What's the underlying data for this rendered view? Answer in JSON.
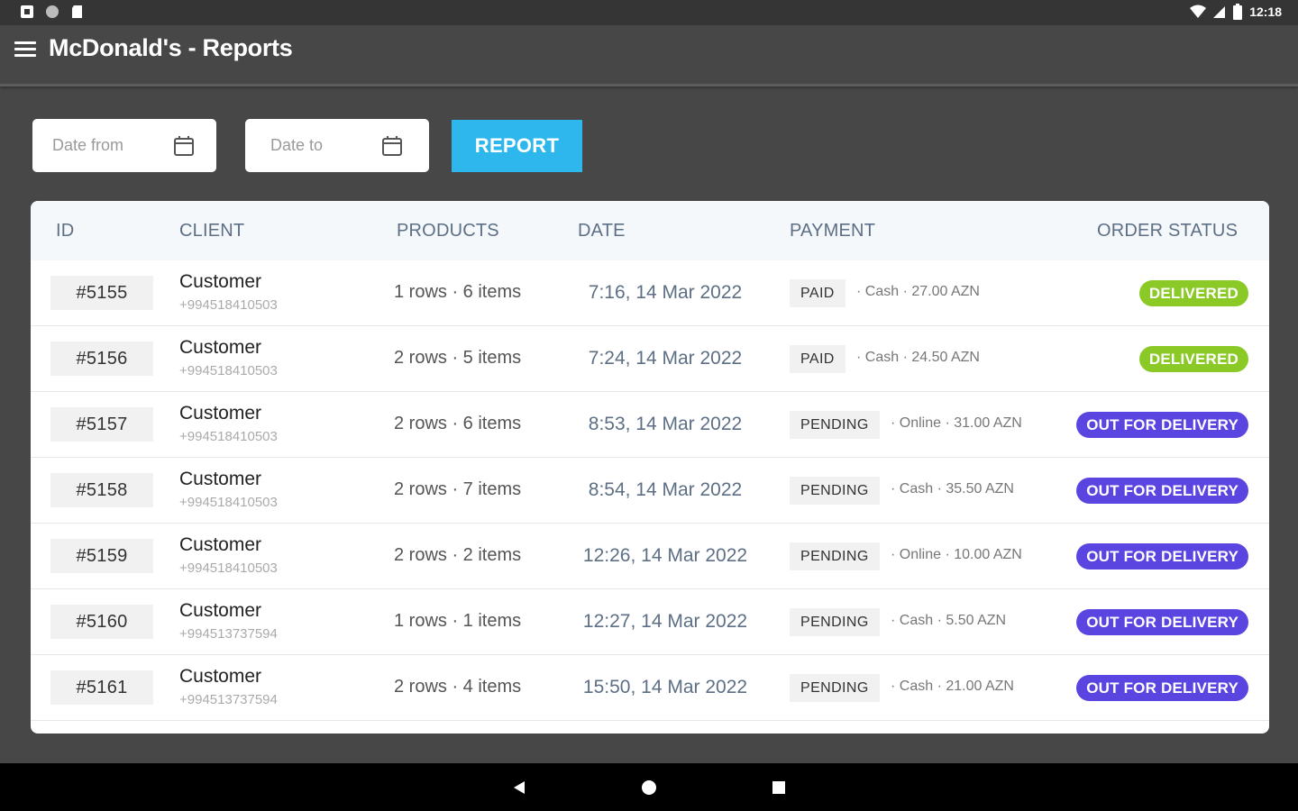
{
  "status_bar": {
    "time": "12:18"
  },
  "app": {
    "title": "McDonald's - Reports"
  },
  "filters": {
    "date_from_placeholder": "Date from",
    "date_to_placeholder": "Date to",
    "report_label": "REPORT"
  },
  "table": {
    "headers": [
      "ID",
      "CLIENT",
      "PRODUCTS",
      "DATE",
      "PAYMENT",
      "ORDER STATUS"
    ],
    "rows": [
      {
        "id": "#5155",
        "client": "Customer",
        "phone": "+994518410503",
        "products": "1 rows · 6 items",
        "date": "7:16, 14 Mar 2022",
        "payment_status": "PAID",
        "method": "Cash",
        "amount": "27.00 AZN",
        "order_status": "DELIVERED"
      },
      {
        "id": "#5156",
        "client": "Customer",
        "phone": "+994518410503",
        "products": "2 rows · 5 items",
        "date": "7:24, 14 Mar 2022",
        "payment_status": "PAID",
        "method": "Cash",
        "amount": "24.50 AZN",
        "order_status": "DELIVERED"
      },
      {
        "id": "#5157",
        "client": "Customer",
        "phone": "+994518410503",
        "products": "2 rows · 6 items",
        "date": "8:53, 14 Mar 2022",
        "payment_status": "PENDING",
        "method": "Online",
        "amount": "31.00 AZN",
        "order_status": "OUT FOR DELIVERY"
      },
      {
        "id": "#5158",
        "client": "Customer",
        "phone": "+994518410503",
        "products": "2 rows · 7 items",
        "date": "8:54, 14 Mar 2022",
        "payment_status": "PENDING",
        "method": "Cash",
        "amount": "35.50 AZN",
        "order_status": "OUT FOR DELIVERY"
      },
      {
        "id": "#5159",
        "client": "Customer",
        "phone": "+994518410503",
        "products": "2 rows · 2 items",
        "date": "12:26, 14 Mar 2022",
        "payment_status": "PENDING",
        "method": "Online",
        "amount": "10.00 AZN",
        "order_status": "OUT FOR DELIVERY"
      },
      {
        "id": "#5160",
        "client": "Customer",
        "phone": "+994513737594",
        "products": "1 rows · 1 items",
        "date": "12:27, 14 Mar 2022",
        "payment_status": "PENDING",
        "method": "Cash",
        "amount": "5.50 AZN",
        "order_status": "OUT FOR DELIVERY"
      },
      {
        "id": "#5161",
        "client": "Customer",
        "phone": "+994513737594",
        "products": "2 rows · 4 items",
        "date": "15:50, 14 Mar 2022",
        "payment_status": "PENDING",
        "method": "Cash",
        "amount": "21.00 AZN",
        "order_status": "OUT FOR DELIVERY"
      }
    ]
  },
  "colors": {
    "background": "#474747",
    "report_button": "#2eb7ec",
    "delivered": "#8ac926",
    "out_for_delivery": "#5b45e0"
  },
  "icons": {
    "status_left": [
      "notification-icon",
      "circle-icon",
      "sd-card-icon"
    ],
    "status_right": [
      "wifi-icon",
      "signal-icon",
      "battery-icon"
    ],
    "nav": [
      "back-icon",
      "home-icon",
      "recents-icon"
    ],
    "date_fields": "calendar-icon",
    "menu": "hamburger-icon"
  }
}
